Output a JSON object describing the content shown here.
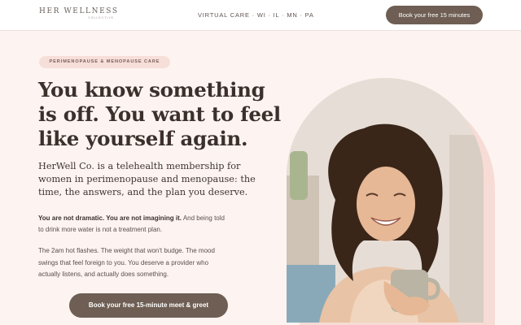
{
  "header": {
    "logo_main": "HER WELLNESS",
    "logo_sub": "COLLECTIVE",
    "nav_text": "VIRTUAL CARE · WI · IL · MN · PA",
    "cta_label": "Book your free 15 minutes"
  },
  "hero": {
    "badge": "PERIMENOPAUSE & MENOPAUSE CARE",
    "headline_lines": [
      "You know something",
      "is off. You want to feel",
      "like yourself again."
    ],
    "subhead_lines": [
      "HerWell Co. is a telehealth membership for",
      "women in perimenopause and menopause: the",
      "time, the answers, and the plan you deserve."
    ],
    "para1_strong": "You are not dramatic. You are not imagining it.",
    "para1_rest": " And being told",
    "para1_line2": "to drink more water is not a treatment plan.",
    "para2_lines": [
      "The 2am hot flashes. The weight that won't budge. The mood",
      "swings that feel foreign to you. You deserve a provider who",
      "actually listens, and actually does something."
    ],
    "cta_label": "Book your free 15-minute meet & greet"
  },
  "colors": {
    "background": "#fdf4f1",
    "button": "#6e5e53",
    "badge": "#f7dfd9",
    "photo_accent": "#f7dcd5"
  }
}
